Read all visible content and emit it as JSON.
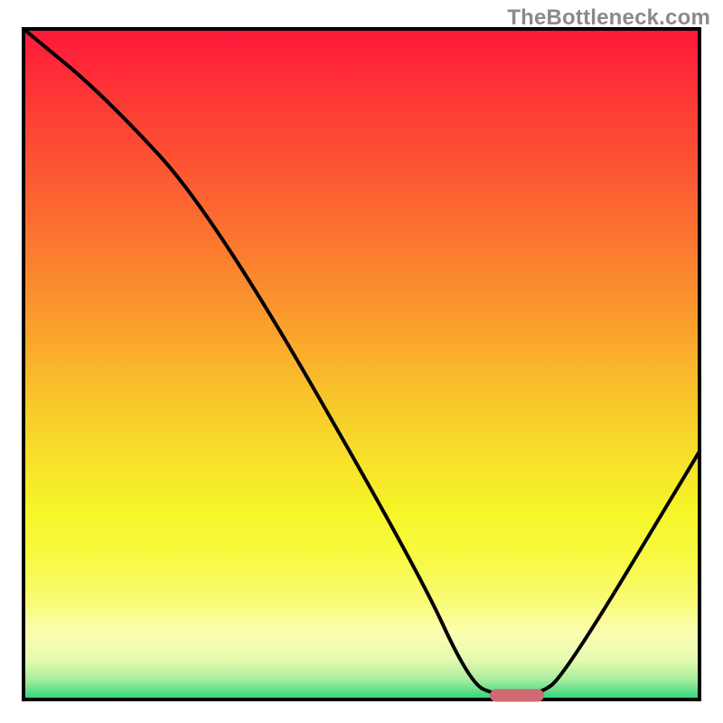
{
  "attribution": "TheBottleneck.com",
  "chart_data": {
    "type": "line",
    "title": "",
    "xlabel": "",
    "ylabel": "",
    "xlim": [
      0,
      100
    ],
    "ylim": [
      0,
      100
    ],
    "series": [
      {
        "name": "curve",
        "points": [
          {
            "x": 0,
            "y": 100
          },
          {
            "x": 12,
            "y": 90
          },
          {
            "x": 28,
            "y": 72.5
          },
          {
            "x": 58,
            "y": 20
          },
          {
            "x": 66,
            "y": 2.5
          },
          {
            "x": 70,
            "y": 0.6
          },
          {
            "x": 76,
            "y": 0.6
          },
          {
            "x": 80,
            "y": 3.5
          },
          {
            "x": 100,
            "y": 37
          }
        ]
      }
    ],
    "marker": {
      "x_start": 69,
      "x_end": 77,
      "y": 0.6,
      "color": "#cf6a72"
    },
    "gradient_stops": [
      {
        "offset": 0.0,
        "color": "#fe183a"
      },
      {
        "offset": 0.14,
        "color": "#fd4234"
      },
      {
        "offset": 0.3,
        "color": "#fb7130"
      },
      {
        "offset": 0.45,
        "color": "#faa22c"
      },
      {
        "offset": 0.58,
        "color": "#f8cf2a"
      },
      {
        "offset": 0.72,
        "color": "#f6f628"
      },
      {
        "offset": 0.78,
        "color": "#f7f93d"
      },
      {
        "offset": 0.85,
        "color": "#f9fb72"
      },
      {
        "offset": 0.9,
        "color": "#fbfdb0"
      },
      {
        "offset": 0.94,
        "color": "#e6faaf"
      },
      {
        "offset": 0.97,
        "color": "#a9ed9f"
      },
      {
        "offset": 1.0,
        "color": "#2ad479"
      }
    ],
    "frame": {
      "stroke": "#000000",
      "width": 4
    },
    "line_style": {
      "stroke": "#000000",
      "width": 4
    }
  }
}
